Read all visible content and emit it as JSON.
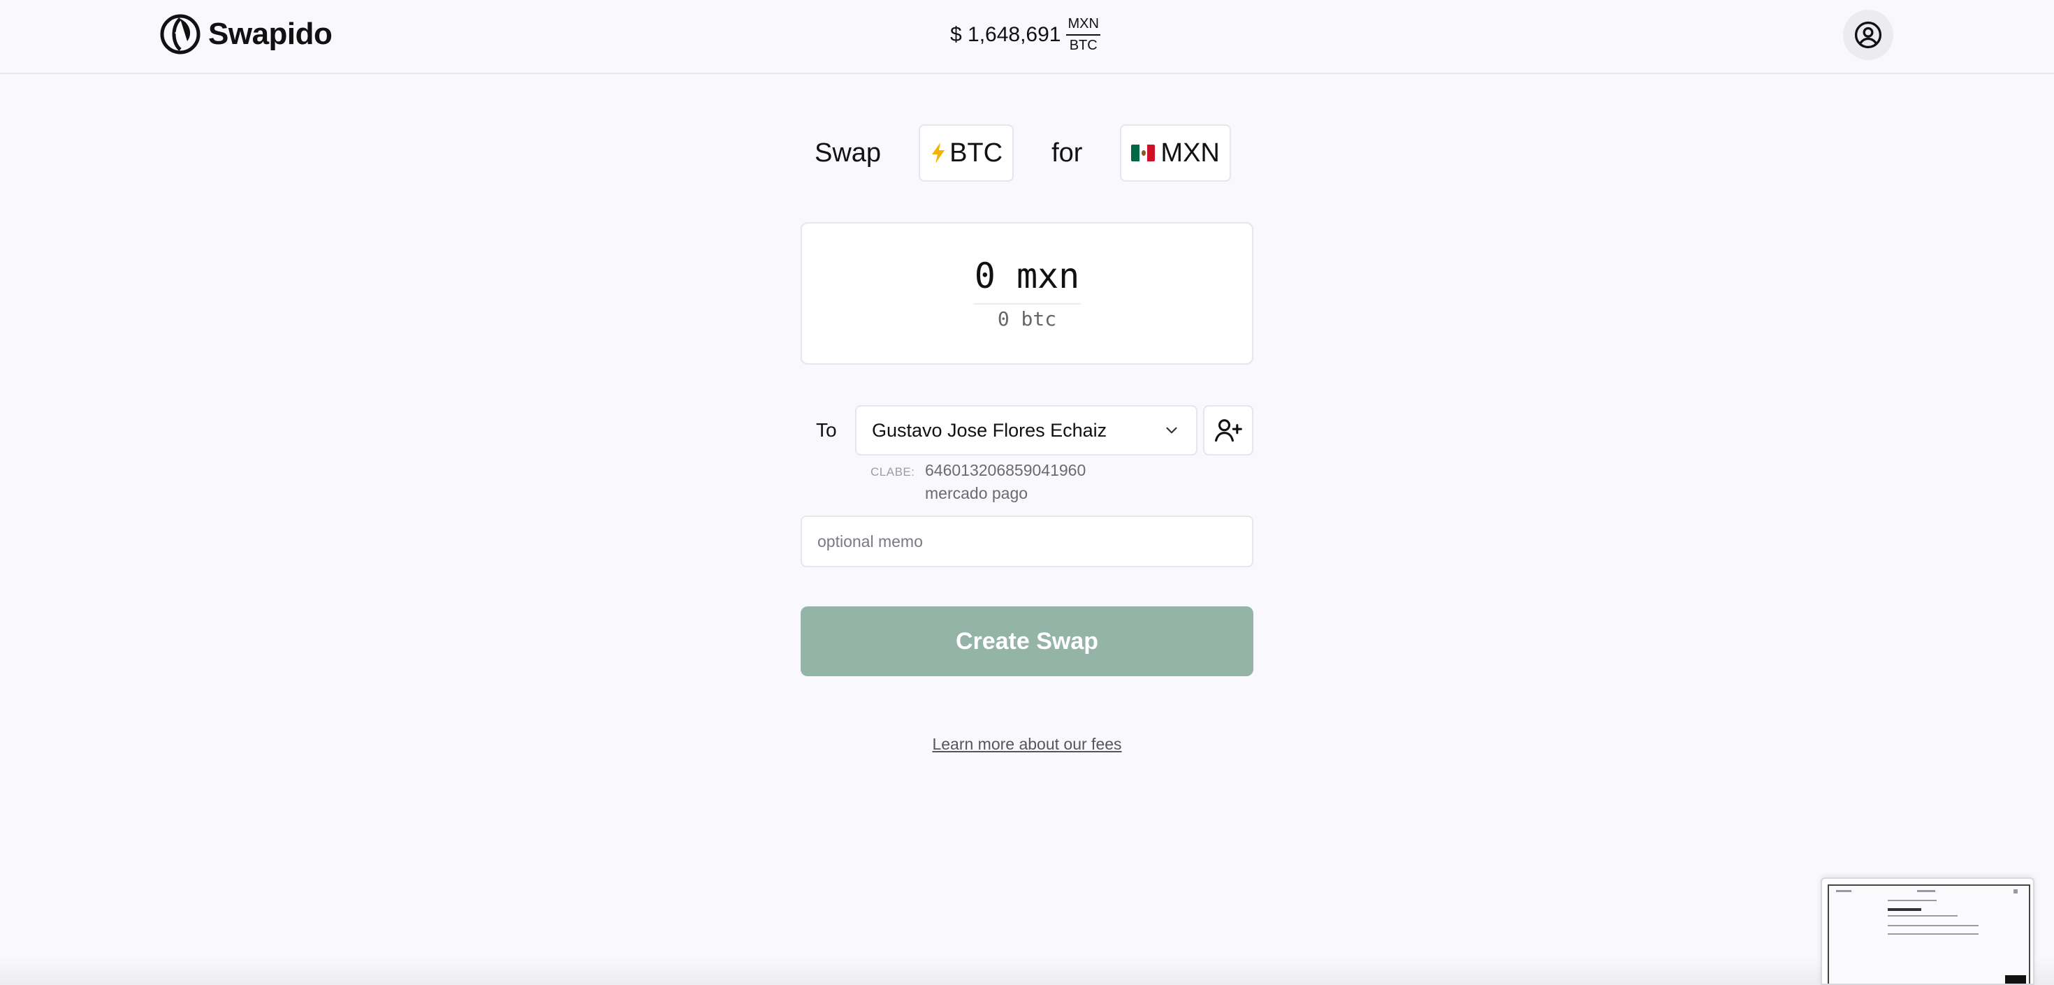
{
  "header": {
    "logo_text": "Swapido",
    "rate_value": "$ 1,648,691",
    "rate_numerator": "MXN",
    "rate_denominator": "BTC"
  },
  "swap": {
    "swap_word": "Swap",
    "from_icon": "lightning-icon",
    "from_currency": "BTC",
    "for_word": "for",
    "to_icon": "mexico-flag-icon",
    "to_currency": "MXN"
  },
  "amount": {
    "primary": "0 mxn",
    "secondary": "0 btc"
  },
  "recipient": {
    "to_label": "To",
    "name": "Gustavo Jose Flores Echaiz",
    "clabe_label": "CLABE:",
    "clabe_value": "646013206859041960",
    "bank": "mercado pago"
  },
  "memo": {
    "placeholder": "optional memo"
  },
  "actions": {
    "create_label": "Create Swap",
    "fees_link": "Learn more about our fees"
  },
  "colors": {
    "background": "#f9f9fd",
    "create_button": "#94b4a8",
    "border": "#e6e6ec"
  }
}
